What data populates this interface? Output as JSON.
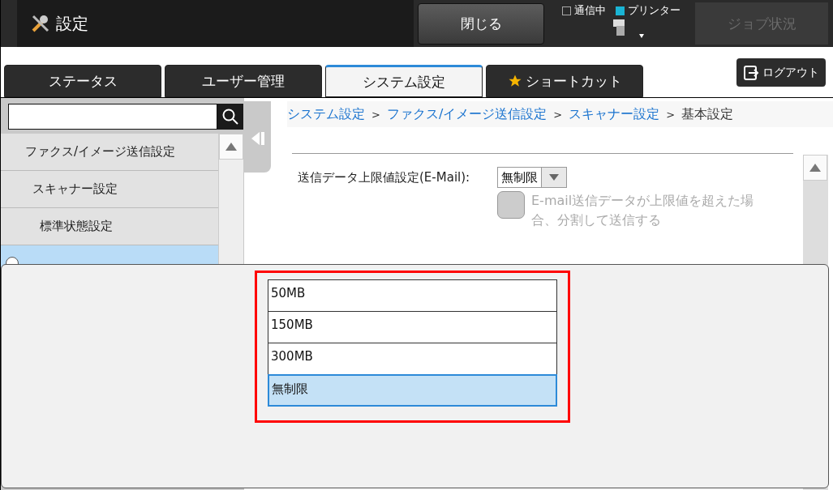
{
  "header": {
    "title": "設定",
    "close_button": "閉じる",
    "indicators": [
      {
        "label": "通信中",
        "on": false
      },
      {
        "label": "プリンター",
        "on": true
      }
    ],
    "job_status": {
      "label": "ジョブ状況",
      "disabled": true
    }
  },
  "tabs": [
    {
      "label": "ステータス",
      "selected": false,
      "starred": false
    },
    {
      "label": "ユーザー管理",
      "selected": false,
      "starred": false
    },
    {
      "label": "システム設定",
      "selected": true,
      "starred": false
    },
    {
      "label": "ショートカット",
      "selected": false,
      "starred": true
    }
  ],
  "logout": "ログアウト",
  "sidebar": {
    "items": [
      {
        "label": "ファクス/イメージ送信設定",
        "selected": false,
        "children": [
          {
            "label": "スキャナー設定",
            "selected": false,
            "children": [
              {
                "label": "標準状態設定",
                "selected": false
              },
              {
                "selected": true
              }
            ]
          }
        ]
      }
    ]
  },
  "breadcrumb": [
    {
      "label": "システム設定",
      "link": true,
      "separator": ">"
    },
    {
      "label": "ファクス/イメージ送信設定",
      "link": true,
      "separator": ">"
    },
    {
      "label": "スキャナー設定",
      "link": true,
      "separator": ">"
    },
    {
      "label": "基本設定",
      "link": false
    }
  ],
  "setting": {
    "label": "送信データ上限値設定(E-Mail):",
    "value": "無制限",
    "option": {
      "label": "E-mail送信データが上限値を超えた場合、分割して送信する",
      "checked": false,
      "disabled": true
    }
  },
  "dropdown": {
    "options": [
      {
        "label": "50MB",
        "selected": false
      },
      {
        "label": "150MB",
        "selected": false
      },
      {
        "label": "300MB",
        "selected": false
      },
      {
        "label": "無制限",
        "selected": true
      }
    ]
  }
}
